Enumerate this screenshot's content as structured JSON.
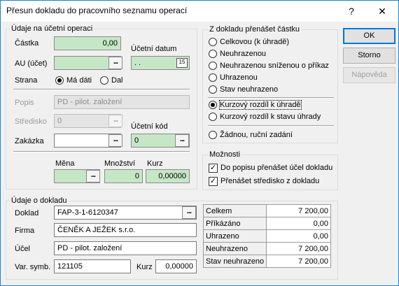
{
  "window": {
    "title": "Přesun dokladu do pracovního seznamu operací",
    "help_glyph": "?",
    "close_glyph": "✕"
  },
  "uc": {
    "legend": "Údaje na účetní operaci",
    "castka_label": "Částka",
    "castka_value": "0,00",
    "au_label": "AU (účet)",
    "ucetni_datum_label": "Účetní datum",
    "ucetni_datum_value": ". .",
    "cal_glyph": "15",
    "strana_label": "Strana",
    "strana_md": "Má dáti",
    "strana_dal": "Dal",
    "popis_label": "Popis",
    "popis_value": "PD - pilot. založení",
    "stredisko_label": "Středisko",
    "stredisko_value": "0",
    "ucetni_kod_label": "Účetní kód",
    "ucetni_kod_value": "0",
    "zakazka_label": "Zakázka",
    "mena_label": "Měna",
    "mnozstvi_label": "Množství",
    "mnozstvi_value": "0",
    "kurz_label": "Kurz",
    "kurz_value": "0,00000",
    "dots": "..."
  },
  "prenos": {
    "legend": "Z dokladu přenášet částku",
    "options": [
      "Celkovou (k úhradě)",
      "Neuhrazenou",
      "Neuhrazenou sníženou o příkaz",
      "Uhrazenou",
      "Stav neuhrazeno",
      "Kurzový rozdíl k úhradě",
      "Kurzový rozdíl k stavu úhrady",
      "Žádnou, ruční zadání"
    ],
    "selected": 5
  },
  "moznosti": {
    "legend": "Možnosti",
    "check1": "Do popisu přenášet účel dokladu",
    "check2": "Přenášet středisko z dokladu",
    "check_glyph": "✓"
  },
  "buttons": {
    "ok": "OK",
    "storno": "Storno",
    "napoveda": "Nápověda"
  },
  "doklad": {
    "legend": "Údaje o dokladu",
    "doklad_label": "Doklad",
    "doklad_value": "FAP-3-1-6120347",
    "firma_label": "Firma",
    "firma_value": "ČENĚK A JEŽEK s.r.o.",
    "ucel_label": "Účel",
    "ucel_value": "PD - pilot. založení",
    "varsymb_label": "Var. symb.",
    "varsymb_value": "121105",
    "kurz_label": "Kurz",
    "kurz_value": "0,00000"
  },
  "summary": [
    {
      "label": "Celkem",
      "value": "7 200,00"
    },
    {
      "label": "Příkázáno",
      "value": "0,00"
    },
    {
      "label": "Uhrazeno",
      "value": "0,00"
    },
    {
      "label": "Neuhrazeno",
      "value": "7 200,00"
    },
    {
      "label": "Stav neuhrazeno",
      "value": "7 200,00"
    }
  ]
}
